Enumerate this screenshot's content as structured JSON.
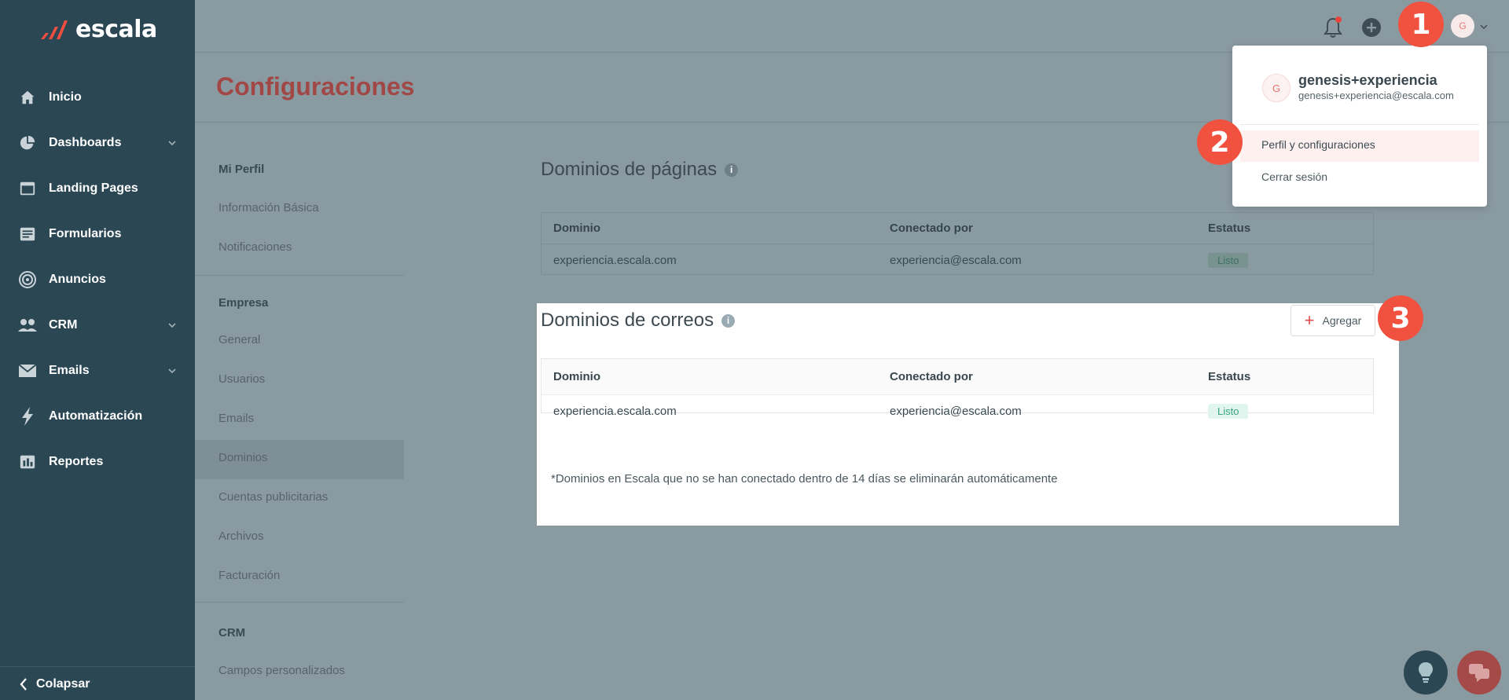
{
  "app": {
    "logo_text": "escala"
  },
  "sidebar": {
    "items": [
      {
        "label": "Inicio",
        "icon": "home-icon",
        "has_chevron": false
      },
      {
        "label": "Dashboards",
        "icon": "pie-chart-icon",
        "has_chevron": true
      },
      {
        "label": "Landing Pages",
        "icon": "browser-window-icon",
        "has_chevron": false
      },
      {
        "label": "Formularios",
        "icon": "form-icon",
        "has_chevron": false
      },
      {
        "label": "Anuncios",
        "icon": "target-icon",
        "has_chevron": false
      },
      {
        "label": "CRM",
        "icon": "users-icon",
        "has_chevron": true
      },
      {
        "label": "Emails",
        "icon": "envelope-icon",
        "has_chevron": true
      },
      {
        "label": "Automatización",
        "icon": "lightning-icon",
        "has_chevron": false
      },
      {
        "label": "Reportes",
        "icon": "report-icon",
        "has_chevron": false
      }
    ],
    "collapse_label": "Colapsar"
  },
  "header": {
    "title": "Configuraciones",
    "avatar_initial": "G"
  },
  "settings_menu": {
    "sections": [
      {
        "title": "Mi Perfil",
        "items": [
          "Información Básica",
          "Notificaciones"
        ]
      },
      {
        "title": "Empresa",
        "items": [
          "General",
          "Usuarios",
          "Emails",
          "Dominios",
          "Cuentas publicitarias",
          "Archivos",
          "Facturación"
        ]
      },
      {
        "title": "CRM",
        "items": [
          "Campos personalizados"
        ]
      }
    ],
    "active_item": "Dominios"
  },
  "page_domains": {
    "title": "Dominios de páginas",
    "columns": [
      "Dominio",
      "Conectado por",
      "Estatus"
    ],
    "rows": [
      {
        "domain": "experiencia.escala.com",
        "connected_by": "experiencia@escala.com",
        "status": "Listo"
      }
    ]
  },
  "email_domains": {
    "title": "Dominios de correos",
    "add_label": "Agregar",
    "columns": [
      "Dominio",
      "Conectado por",
      "Estatus"
    ],
    "rows": [
      {
        "domain": "experiencia.escala.com",
        "connected_by": "experiencia@escala.com",
        "status": "Listo"
      }
    ],
    "footnote": "*Dominios en Escala que no se han conectado dentro de 14 días se eliminarán automáticamente"
  },
  "user_menu": {
    "initial": "G",
    "name": "genesis+experiencia",
    "email": "genesis+experiencia@escala.com",
    "items": [
      "Perfil y configuraciones",
      "Cerrar sesión"
    ]
  },
  "markers": [
    "1",
    "2",
    "3"
  ],
  "colors": {
    "sidebar": "#2b4754",
    "accent": "#f0523f",
    "title": "#a14846",
    "badge_bg": "#dff5ee",
    "badge_text": "#3aa483"
  }
}
